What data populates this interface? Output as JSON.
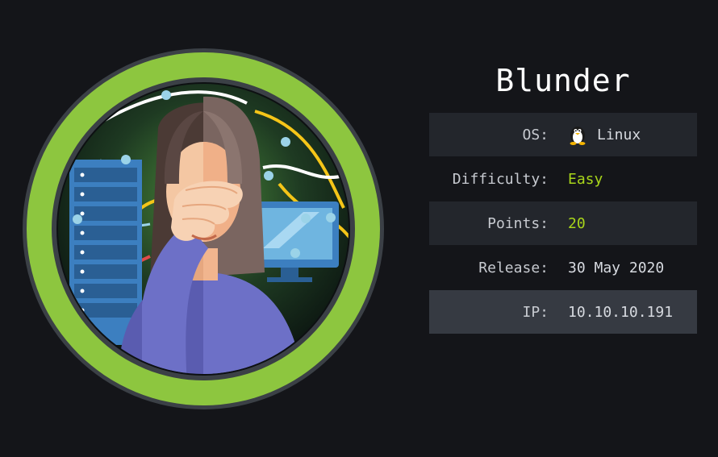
{
  "machine": {
    "name": "Blunder"
  },
  "info": {
    "os_label": "OS:",
    "os_value": "Linux",
    "os_icon": "tux-penguin-icon",
    "difficulty_label": "Difficulty:",
    "difficulty_value": "Easy",
    "points_label": "Points:",
    "points_value": "20",
    "release_label": "Release:",
    "release_value": "30 May 2020",
    "ip_label": "IP:",
    "ip_value": "10.10.10.191"
  },
  "colors": {
    "background": "#141519",
    "ring": "#8dc63f",
    "accent_green": "#a8d51a",
    "row_shaded": "#23262c",
    "row_highlight": "#363a42"
  }
}
